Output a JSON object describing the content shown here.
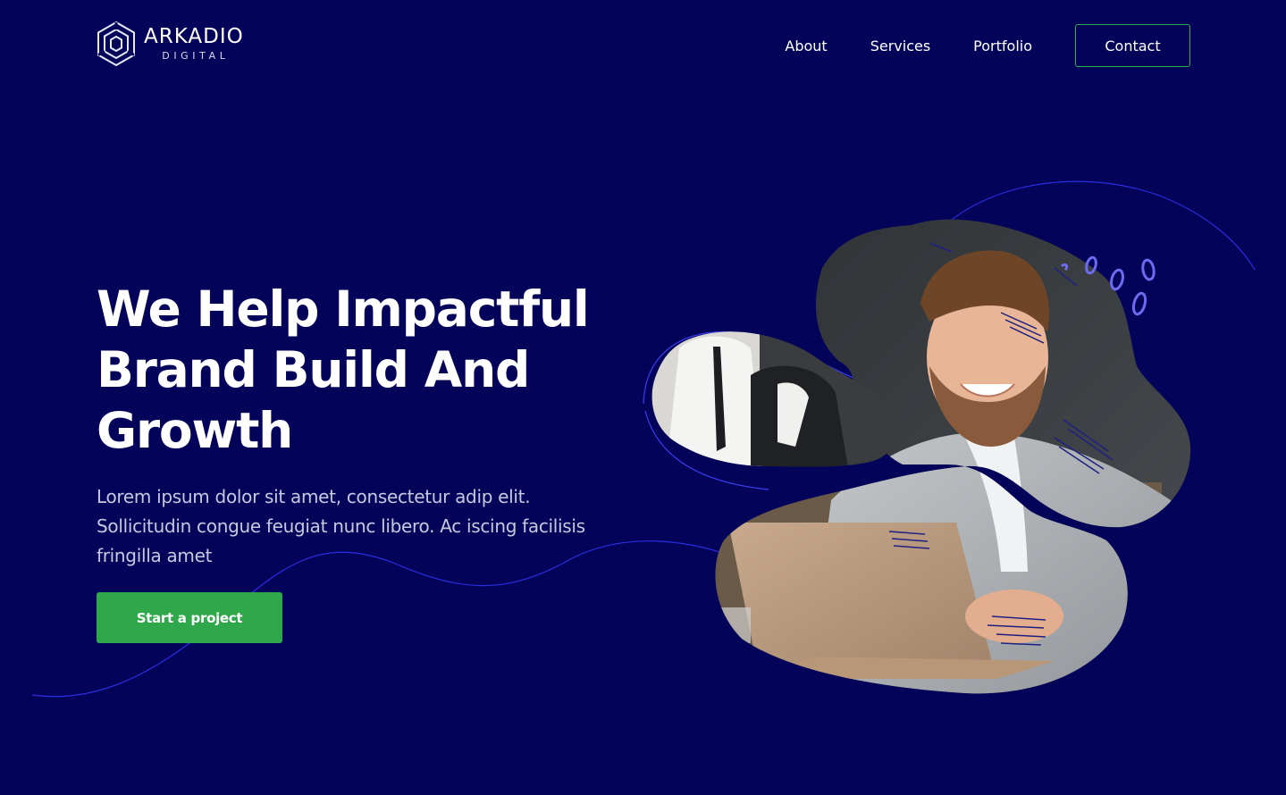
{
  "brand": {
    "name": "ARKADIO",
    "tagline": "DIGITAL",
    "logo_icon": "hexagon-logo-icon"
  },
  "nav": {
    "links": [
      "About",
      "Services",
      "Portfolio"
    ],
    "contact_label": "Contact"
  },
  "hero": {
    "title": "We Help Impactful Brand Build And Growth",
    "description": "Lorem ipsum dolor sit amet, consectetur adip elit. Sollicitudin congue feugiat nunc libero. Ac iscing facilisis fringilla amet",
    "cta_label": "Start a project"
  },
  "colors": {
    "background": "#03035a",
    "accent_green": "#2ea84a",
    "line_blue": "#2a2ee0",
    "squiggle": "#6c6cf0"
  }
}
